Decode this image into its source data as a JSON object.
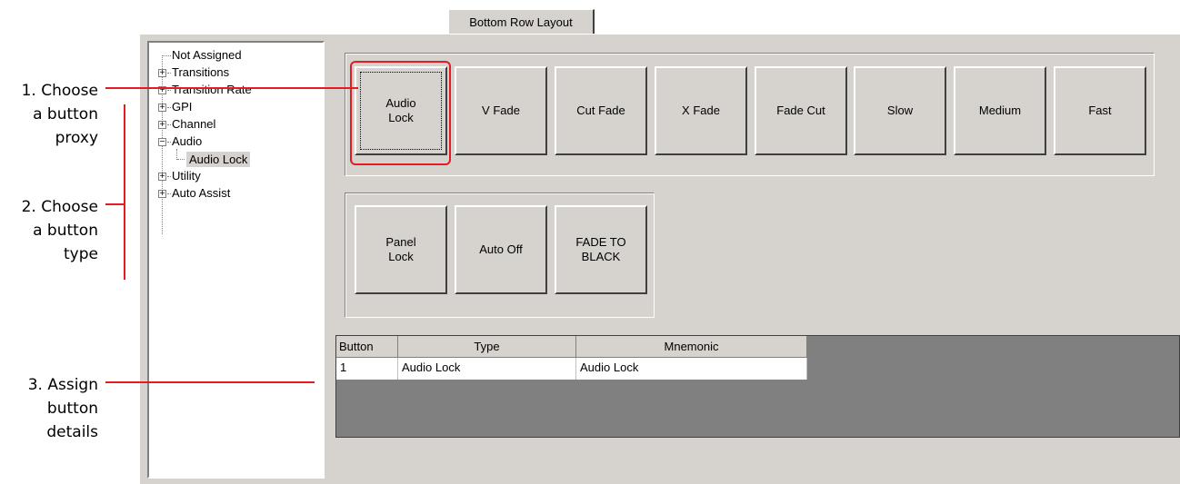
{
  "annotations": {
    "step1": [
      "1. Choose",
      "a button",
      "proxy"
    ],
    "step2": [
      "2. Choose",
      "a button",
      "type"
    ],
    "step3": [
      "3. Assign",
      "button",
      "details"
    ],
    "line_color": "#e31b23"
  },
  "tab": {
    "label": "Bottom Row Layout"
  },
  "tree": {
    "items": [
      {
        "label": "Not Assigned",
        "expander": "none"
      },
      {
        "label": "Transitions",
        "expander": "plus"
      },
      {
        "label": "Transition Rate",
        "expander": "plus"
      },
      {
        "label": "GPI",
        "expander": "plus"
      },
      {
        "label": "Channel",
        "expander": "plus"
      },
      {
        "label": "Audio",
        "expander": "minus"
      },
      {
        "label": "Audio Lock",
        "expander": "none",
        "selected": true
      },
      {
        "label": "Utility",
        "expander": "plus"
      },
      {
        "label": "Auto Assist",
        "expander": "plus"
      }
    ]
  },
  "row1": {
    "buttons": [
      "Audio\nLock",
      "V Fade",
      "Cut Fade",
      "X Fade",
      "Fade Cut",
      "Slow",
      "Medium",
      "Fast"
    ]
  },
  "row2": {
    "buttons": [
      "Panel\nLock",
      "Auto Off",
      "FADE TO\nBLACK"
    ]
  },
  "grid": {
    "headers": [
      "Button",
      "Type",
      "Mnemonic"
    ],
    "rows": [
      [
        "1",
        "Audio Lock",
        "Audio Lock"
      ]
    ]
  },
  "colors": {
    "panel": "#d6d3ce",
    "grid_bg": "#808080",
    "selection": "#d6d3ce"
  }
}
